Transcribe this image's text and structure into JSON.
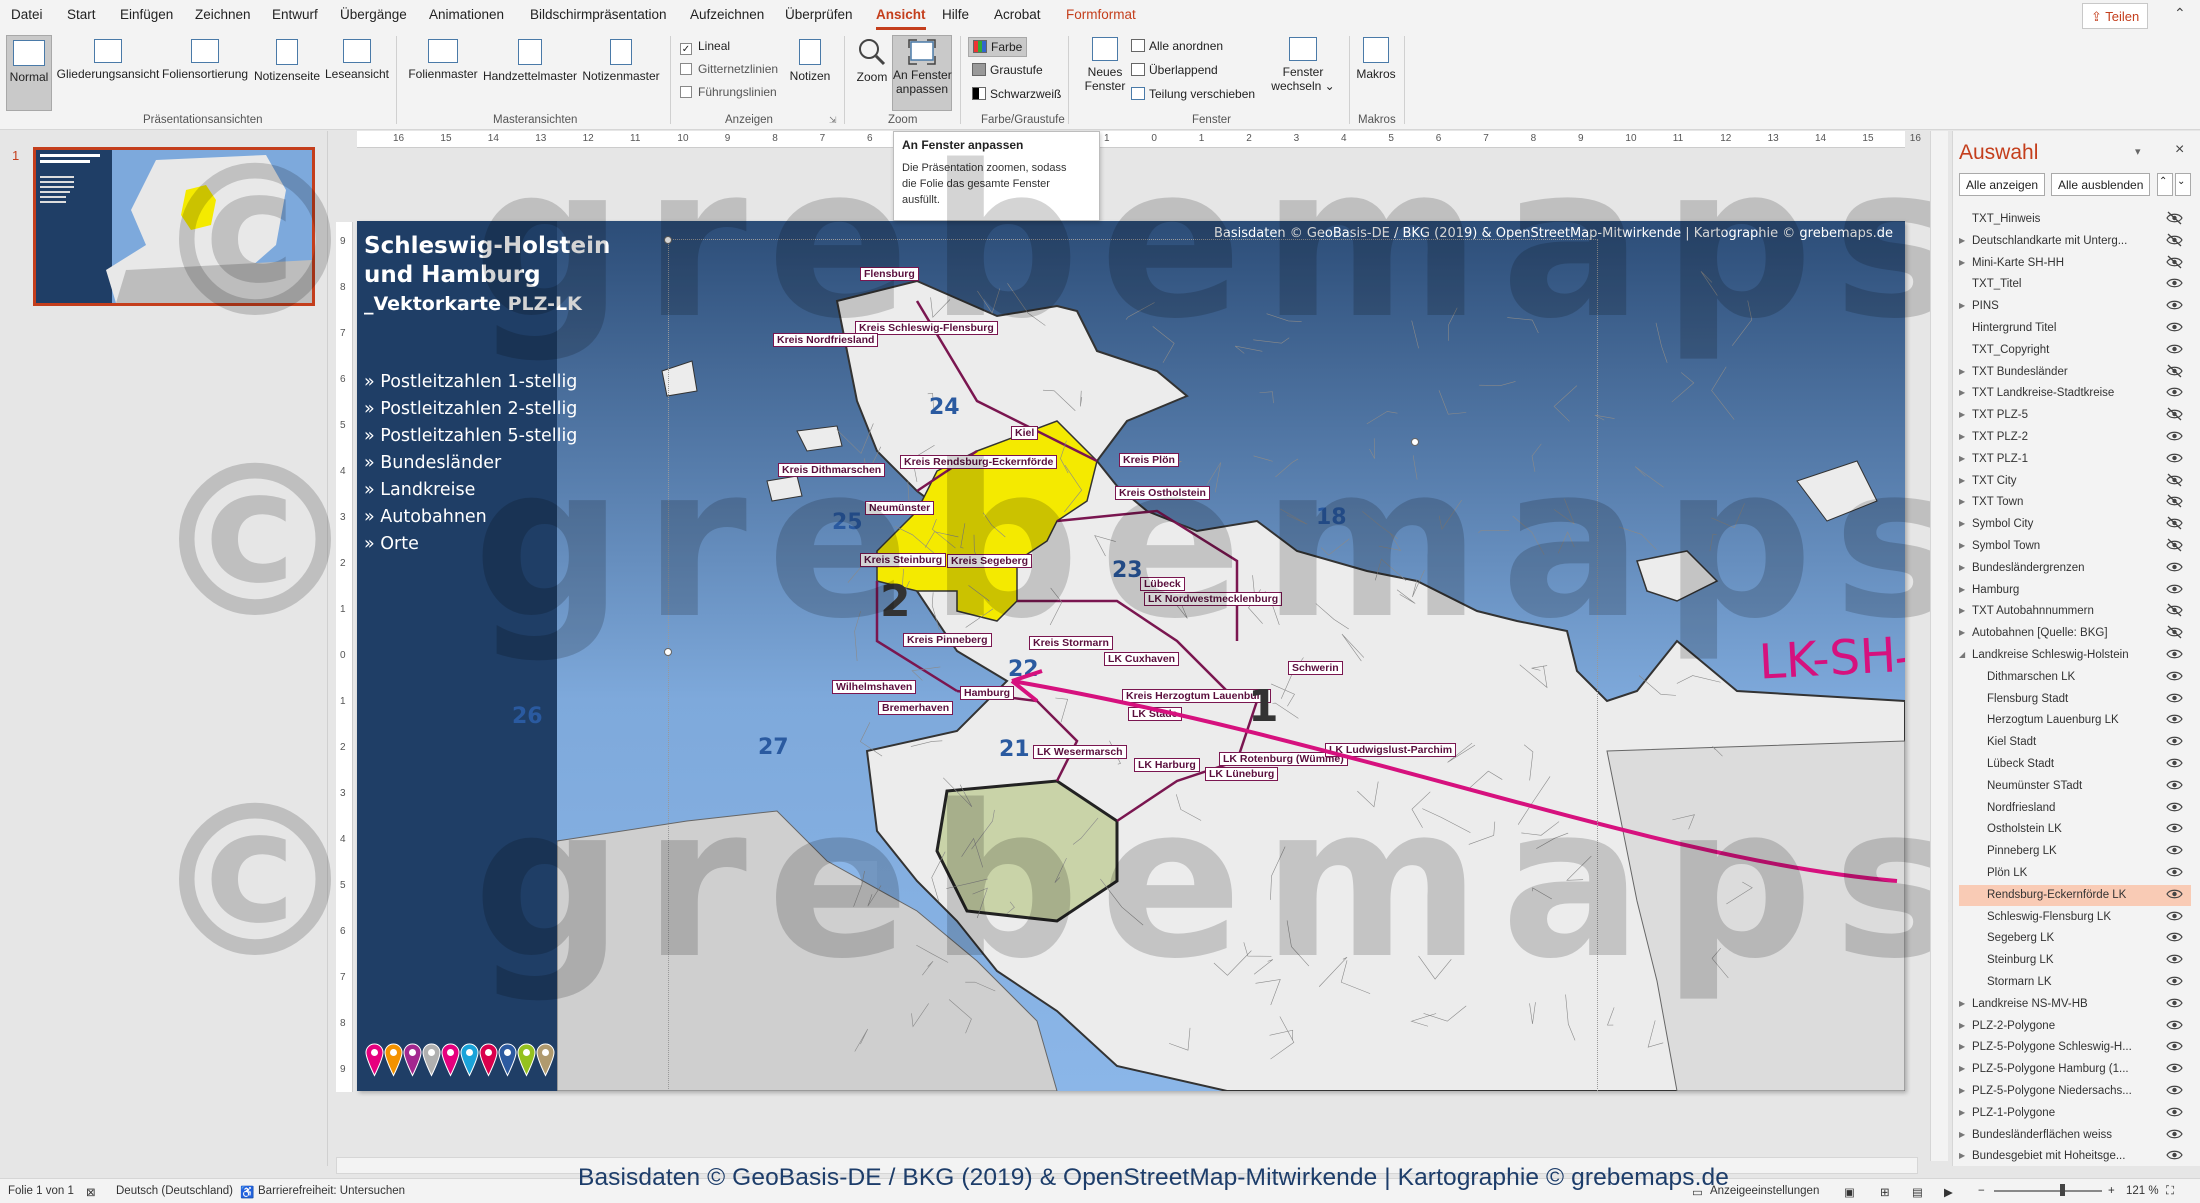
{
  "menu": {
    "tabs": [
      "Datei",
      "Start",
      "Einfügen",
      "Zeichnen",
      "Entwurf",
      "Übergänge",
      "Animationen",
      "Bildschirmpräsentation",
      "Aufzeichnen",
      "Überprüfen",
      "Ansicht",
      "Hilfe",
      "Acrobat",
      "Formformat"
    ],
    "active_tab": "Ansicht",
    "share_label": "Teilen"
  },
  "ribbon": {
    "groups": {
      "presentation_views": "Präsentationsansichten",
      "master_views": "Masteransichten",
      "show": "Anzeigen",
      "zoom": "Zoom",
      "color": "Farbe/Graustufe",
      "window": "Fenster",
      "macros": "Makros"
    },
    "buttons": {
      "normal": "Normal",
      "outline": "Gliederungsansicht",
      "sorter": "Foliensortierung",
      "notes_page": "Notizenseite",
      "reading": "Leseansicht",
      "slide_master": "Folienmaster",
      "handout_master": "Handzettelmaster",
      "notes_master": "Notizenmaster",
      "ruler": "Lineal",
      "gridlines": "Gitternetzlinien",
      "guides": "Führungslinien",
      "notes": "Notizen",
      "zoom": "Zoom",
      "fit1": "An Fenster",
      "fit2": "anpassen",
      "color": "Farbe",
      "grayscale": "Graustufe",
      "bw": "Schwarzweiß",
      "new_window1": "Neues",
      "new_window2": "Fenster",
      "arrange_all": "Alle anordnen",
      "cascade": "Überlappend",
      "split": "Teilung verschieben",
      "switch1": "Fenster",
      "switch2": "wechseln",
      "macros": "Makros"
    }
  },
  "tooltip": {
    "title": "An Fenster anpassen",
    "desc1": "Die Präsentation zoomen, sodass",
    "desc2": "die Folie das gesamte Fenster",
    "desc3": "ausfüllt."
  },
  "thumbnails": {
    "slide_number": "1"
  },
  "slide": {
    "credit": "Basisdaten © GeoBasis-DE / BKG (2019) & OpenStreetMap-Mitwirkende | Kartographie © grebemaps.de",
    "title_line1": "Schleswig-Holstein",
    "title_line2": "und Hamburg",
    "title_line3": "_Vektorkarte PLZ-LK",
    "bullets": [
      "» Postleitzahlen 1-stellig",
      "» Postleitzahlen 2-stellig",
      "» Postleitzahlen 5-stellig",
      "» Bundesländer",
      "» Landkreise",
      "» Autobahnen",
      "» Orte"
    ],
    "pin_colors": [
      "#e6007e",
      "#f39200",
      "#a3278f",
      "#b0b0b0",
      "#e6007e",
      "#1aa3d9",
      "#d9004c",
      "#2c5aa0",
      "#95c11f",
      "#b09a6e"
    ],
    "districts": [
      "Flensburg",
      "Kreis Schleswig-Flensburg",
      "Kreis Nordfriesland",
      "Kiel",
      "Kreis Plön",
      "Kreis Dithmarschen",
      "Kreis Rendsburg-Eckernförde",
      "Kreis Ostholstein",
      "Neumünster",
      "Kreis Steinburg",
      "Kreis Segeberg",
      "Lübeck",
      "LK Nordwestmecklenburg",
      "Kreis Pinneberg",
      "Kreis Stormarn",
      "LK Cuxhaven",
      "Schwerin",
      "Wilhelmshaven",
      "Hamburg",
      "Kreis Herzogtum Lauenburg",
      "LK Stade",
      "Bremerhaven",
      "LK Wesermarsch",
      "LK Rotenburg (Wümme)",
      "LK Harburg",
      "LK Lüneburg",
      "LK Ludwigslust-Parchim"
    ],
    "zones": [
      "24",
      "25",
      "2",
      "23",
      "22",
      "18",
      "1",
      "26",
      "27",
      "21"
    ],
    "annotation": "LK-SH"
  },
  "selection_pane": {
    "title": "Auswahl",
    "show_all": "Alle anzeigen",
    "hide_all": "Alle ausblenden",
    "items": [
      {
        "name": "TXT_Hinweis",
        "hidden": true,
        "indent": 0,
        "tri": ""
      },
      {
        "name": "Deutschlandkarte mit Unterg...",
        "hidden": true,
        "indent": 0,
        "tri": "▶"
      },
      {
        "name": "Mini-Karte SH-HH",
        "hidden": true,
        "indent": 0,
        "tri": "▶"
      },
      {
        "name": "TXT_Titel",
        "hidden": false,
        "indent": 0,
        "tri": ""
      },
      {
        "name": "PINS",
        "hidden": false,
        "indent": 0,
        "tri": "▶"
      },
      {
        "name": "Hintergrund Titel",
        "hidden": false,
        "indent": 0,
        "tri": ""
      },
      {
        "name": "TXT_Copyright",
        "hidden": false,
        "indent": 0,
        "tri": ""
      },
      {
        "name": "TXT Bundesländer",
        "hidden": true,
        "indent": 0,
        "tri": "▶"
      },
      {
        "name": "TXT Landkreise-Stadtkreise",
        "hidden": false,
        "indent": 0,
        "tri": "▶"
      },
      {
        "name": "TXT PLZ-5",
        "hidden": true,
        "indent": 0,
        "tri": "▶"
      },
      {
        "name": "TXT PLZ-2",
        "hidden": false,
        "indent": 0,
        "tri": "▶"
      },
      {
        "name": "TXT PLZ-1",
        "hidden": false,
        "indent": 0,
        "tri": "▶"
      },
      {
        "name": "TXT City",
        "hidden": true,
        "indent": 0,
        "tri": "▶"
      },
      {
        "name": "TXT Town",
        "hidden": true,
        "indent": 0,
        "tri": "▶"
      },
      {
        "name": "Symbol City",
        "hidden": true,
        "indent": 0,
        "tri": "▶"
      },
      {
        "name": "Symbol Town",
        "hidden": true,
        "indent": 0,
        "tri": "▶"
      },
      {
        "name": "Bundesländergrenzen",
        "hidden": false,
        "indent": 0,
        "tri": "▶"
      },
      {
        "name": "Hamburg",
        "hidden": false,
        "indent": 0,
        "tri": "▶"
      },
      {
        "name": "TXT Autobahnnummern",
        "hidden": true,
        "indent": 0,
        "tri": "▶"
      },
      {
        "name": "Autobahnen [Quelle: BKG]",
        "hidden": true,
        "indent": 0,
        "tri": "▶"
      },
      {
        "name": "Landkreise Schleswig-Holstein",
        "hidden": false,
        "indent": 0,
        "tri": "◢"
      },
      {
        "name": "Dithmarschen LK",
        "hidden": false,
        "indent": 1,
        "tri": ""
      },
      {
        "name": "Flensburg Stadt",
        "hidden": false,
        "indent": 1,
        "tri": ""
      },
      {
        "name": "Herzogtum Lauenburg LK",
        "hidden": false,
        "indent": 1,
        "tri": ""
      },
      {
        "name": "Kiel Stadt",
        "hidden": false,
        "indent": 1,
        "tri": ""
      },
      {
        "name": "Lübeck Stadt",
        "hidden": false,
        "indent": 1,
        "tri": ""
      },
      {
        "name": "Neumünster STadt",
        "hidden": false,
        "indent": 1,
        "tri": ""
      },
      {
        "name": "Nordfriesland",
        "hidden": false,
        "indent": 1,
        "tri": ""
      },
      {
        "name": "Ostholstein LK",
        "hidden": false,
        "indent": 1,
        "tri": ""
      },
      {
        "name": "Pinneberg LK",
        "hidden": false,
        "indent": 1,
        "tri": ""
      },
      {
        "name": "Plön LK",
        "hidden": false,
        "indent": 1,
        "tri": ""
      },
      {
        "name": "Rendsburg-Eckernförde LK",
        "hidden": false,
        "indent": 1,
        "tri": "",
        "highlight": true
      },
      {
        "name": "Schleswig-Flensburg LK",
        "hidden": false,
        "indent": 1,
        "tri": ""
      },
      {
        "name": "Segeberg LK",
        "hidden": false,
        "indent": 1,
        "tri": ""
      },
      {
        "name": "Steinburg LK",
        "hidden": false,
        "indent": 1,
        "tri": ""
      },
      {
        "name": "Stormarn LK",
        "hidden": false,
        "indent": 1,
        "tri": ""
      },
      {
        "name": "Landkreise NS-MV-HB",
        "hidden": false,
        "indent": 0,
        "tri": "▶"
      },
      {
        "name": "PLZ-2-Polygone",
        "hidden": false,
        "indent": 0,
        "tri": "▶"
      },
      {
        "name": "PLZ-5-Polygone Schleswig-H...",
        "hidden": false,
        "indent": 0,
        "tri": "▶"
      },
      {
        "name": "PLZ-5-Polygone Hamburg (1...",
        "hidden": false,
        "indent": 0,
        "tri": "▶"
      },
      {
        "name": "PLZ-5-Polygone Niedersachs...",
        "hidden": false,
        "indent": 0,
        "tri": "▶"
      },
      {
        "name": "PLZ-1-Polygone",
        "hidden": false,
        "indent": 0,
        "tri": "▶"
      },
      {
        "name": "Bundesländerflächen weiss",
        "hidden": false,
        "indent": 0,
        "tri": "▶"
      },
      {
        "name": "Bundesgebiet mit Hoheitsge...",
        "hidden": false,
        "indent": 0,
        "tri": "▶"
      }
    ]
  },
  "status": {
    "slide_of": "Folie 1 von 1",
    "language": "Deutsch (Deutschland)",
    "accessibility": "Barrierefreiheit: Untersuchen",
    "display_settings": "Anzeigeeinstellungen",
    "zoom": "121 %"
  },
  "credit_bar": "Basisdaten © GeoBasis-DE / BKG (2019) & OpenStreetMap-Mitwirkende | Kartographie © grebemaps.de",
  "watermark": "© grebemaps"
}
